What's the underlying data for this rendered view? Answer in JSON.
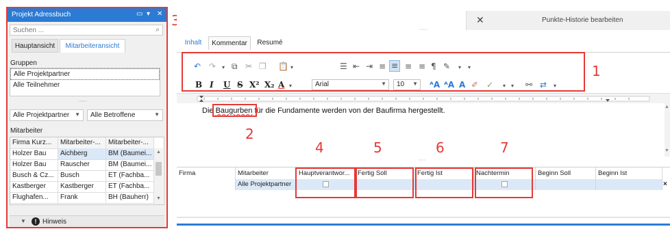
{
  "left_panel": {
    "title": "Projekt Adressbuch",
    "search_placeholder": "Suchen ...",
    "tabs": [
      "Hauptansicht",
      "Mitarbeiteransicht"
    ],
    "groups_label": "Gruppen",
    "groups": [
      "Alle Projektpartner",
      "Alle Teilnehmer"
    ],
    "filter1": "Alle Projektpartner",
    "filter2": "Alle Betroffene",
    "employees_label": "Mitarbeiter",
    "table_headers": [
      "Firma Kurz...",
      "Mitarbeiter-...",
      "Mitarbeiter-..."
    ],
    "rows": [
      [
        "Holzer Bau",
        "Aichberg",
        "BM (Baumei..."
      ],
      [
        "Holzer Bau",
        "Rauscher",
        "BM (Baumei..."
      ],
      [
        "Busch & Cz...",
        "Busch",
        "ET (Fachba..."
      ],
      [
        "Kastberger",
        "Kastberger",
        "ET (Fachba..."
      ],
      [
        "Flughafen...",
        "Frank",
        "BH (Bauherr)"
      ]
    ],
    "hinweis_label": "Hinweis"
  },
  "right_panel": {
    "punkte_label": "Punkte-Historie bearbeiten",
    "tabs": [
      "Inhalt",
      "Kommentar",
      "Resumé"
    ],
    "font_name": "Arial",
    "font_size": "10",
    "editor_text_before": "Die ",
    "editor_highlight": "Baugurben",
    "editor_text_after": " für die Fundamente werden von der Baufirma hergestellt.",
    "grid_headers": [
      "Firma",
      "Mitarbeiter",
      "Hauptverantwor...",
      "Fertig Soll",
      "Fertig Ist",
      "Nachtermin",
      "Beginn Soll",
      "Beginn Ist"
    ],
    "grid_row": {
      "mitarbeiter": "Alle Projektpartner"
    }
  },
  "callouts": [
    "1",
    "2",
    "3",
    "4",
    "5",
    "6",
    "7"
  ],
  "colors": {
    "accent": "#2b7bd4",
    "annotation": "#e53935",
    "selection": "#dbe8f7"
  }
}
